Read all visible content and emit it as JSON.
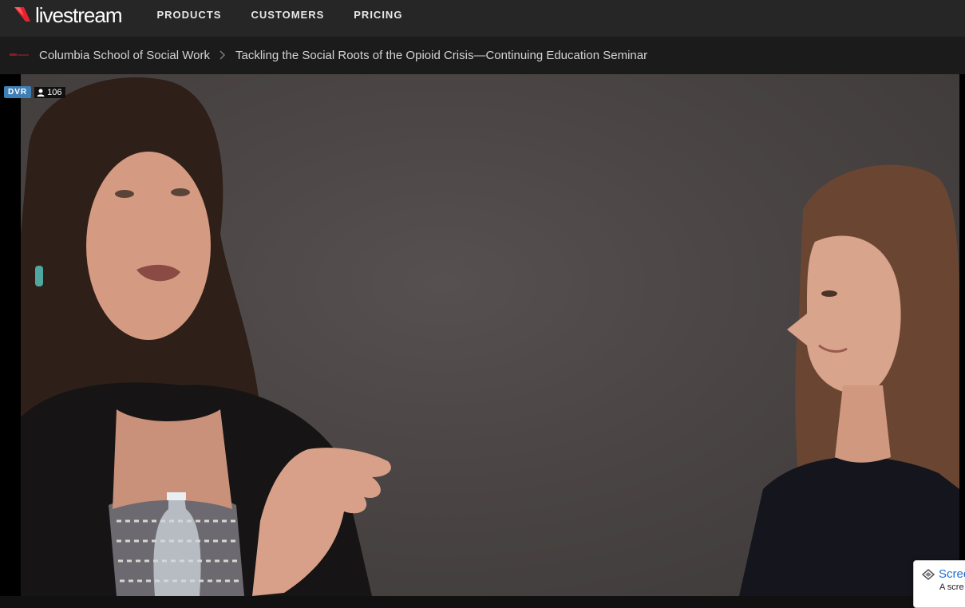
{
  "brand": {
    "name": "livestream",
    "accent": "#e8212e"
  },
  "nav": {
    "items": [
      {
        "label": "PRODUCTS"
      },
      {
        "label": "CUSTOMERS"
      },
      {
        "label": "PRICING"
      }
    ]
  },
  "breadcrumb": {
    "channel": "Columbia School of Social Work",
    "separator": ">",
    "event": "Tackling the Social Roots of the Opioid Crisis—Continuing Education Seminar"
  },
  "player": {
    "dvr_label": "DVR",
    "dvr_color": "#3f7fb5",
    "viewer_count": "106",
    "viewer_icon": "person-icon"
  },
  "popup": {
    "title": "Scree",
    "subtitle": "A scre",
    "icon": "screencast-logo-icon"
  }
}
